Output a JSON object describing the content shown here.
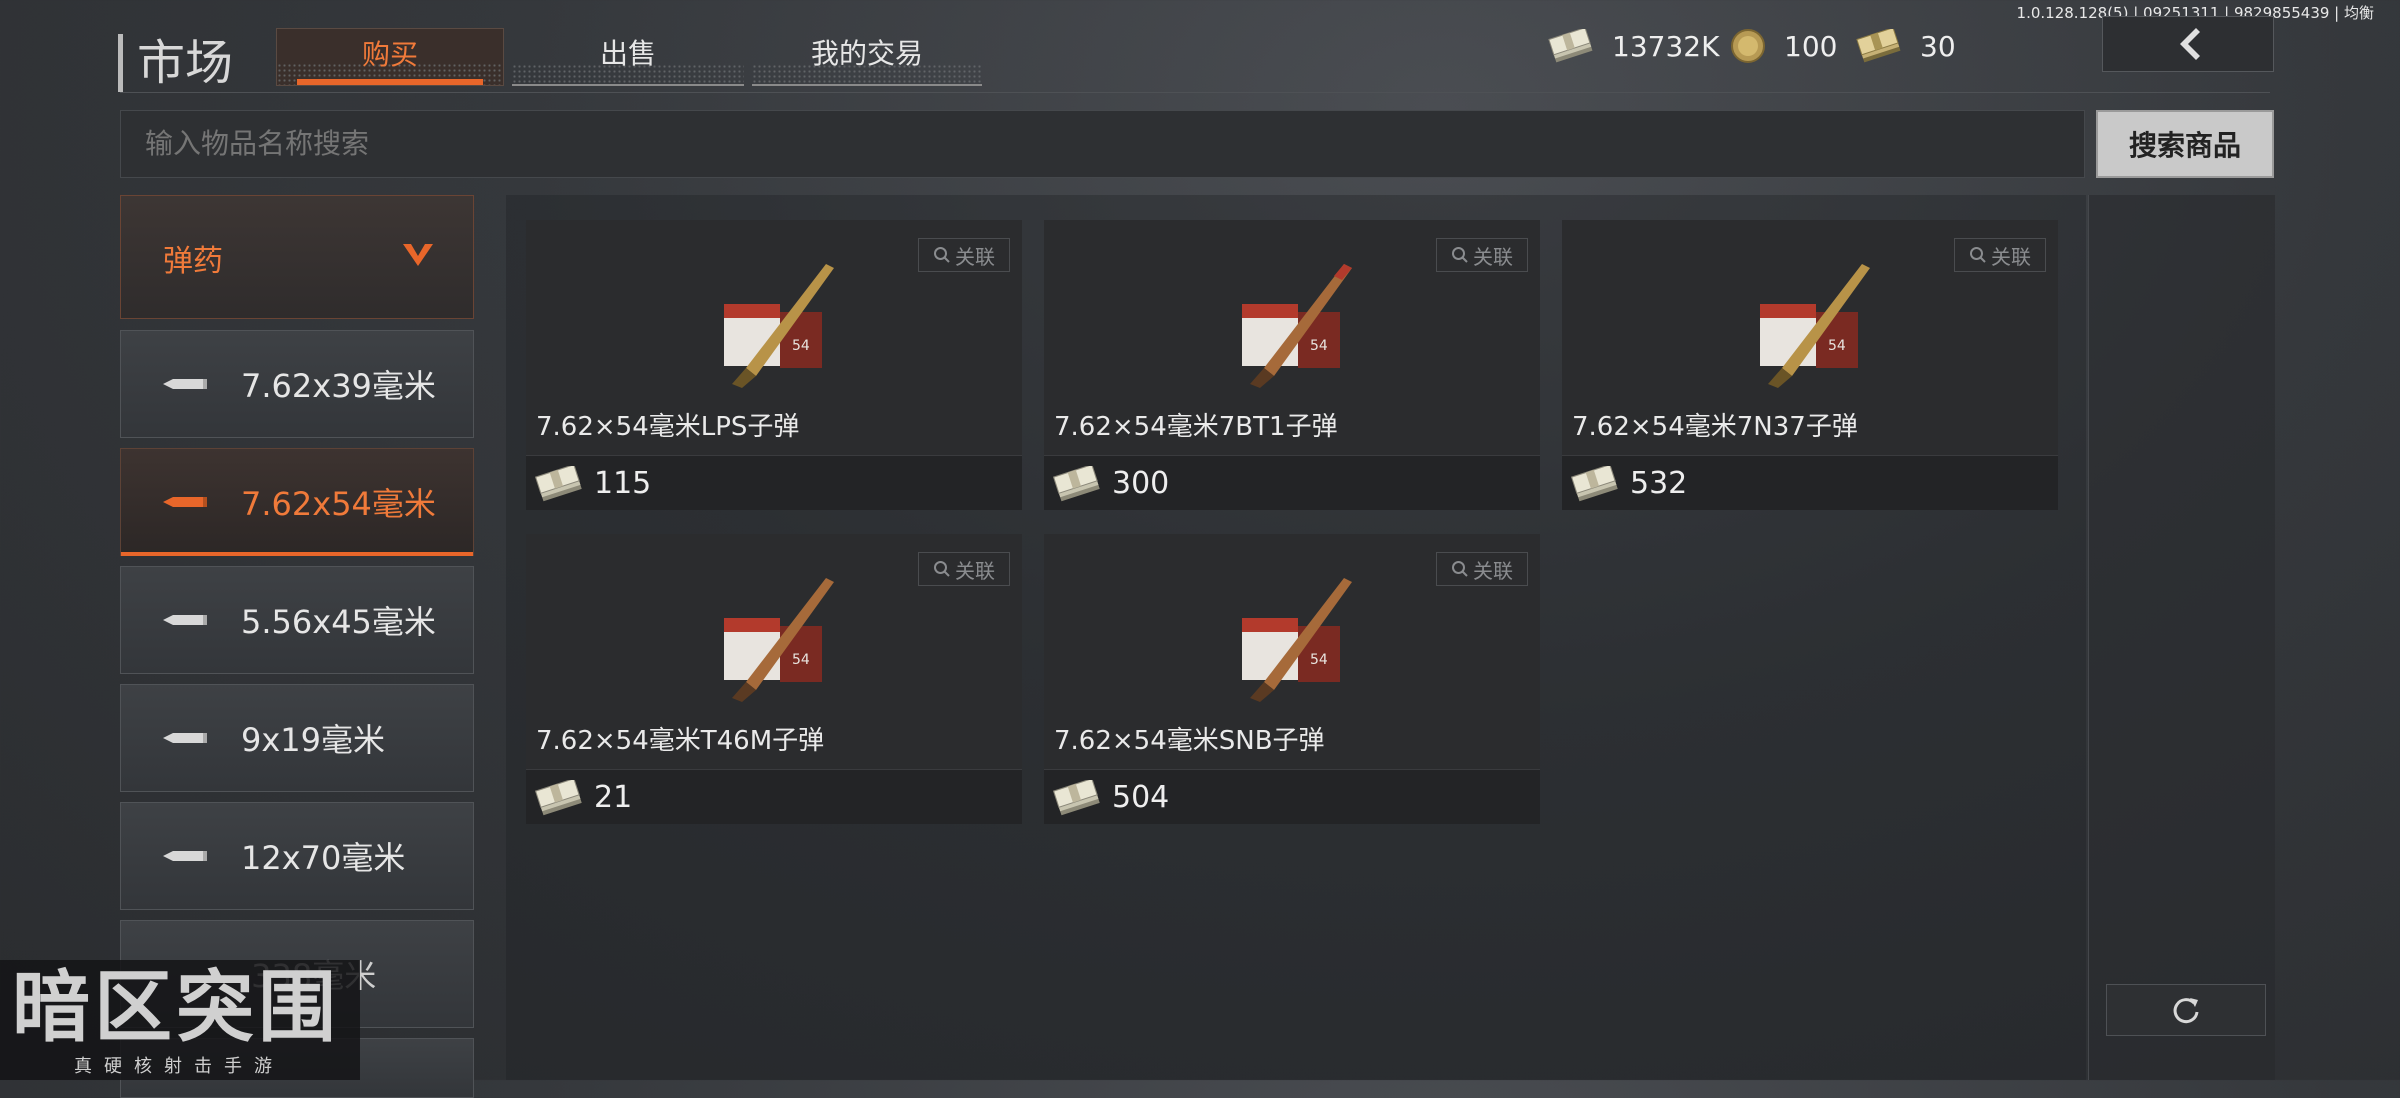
{
  "header": {
    "title": "市场",
    "tabs": [
      {
        "label": "购买",
        "active": true
      },
      {
        "label": "出售",
        "active": false
      },
      {
        "label": "我的交易",
        "active": false
      }
    ],
    "version": "1.0.128.128(5) | 09251311 | 9829855439 | 均衡"
  },
  "currencies": [
    {
      "icon": "cash-bundle-icon",
      "value": "13732K"
    },
    {
      "icon": "gold-coin-icon",
      "value": "100"
    },
    {
      "icon": "voucher-bundle-icon",
      "value": "30"
    }
  ],
  "search": {
    "placeholder": "输入物品名称搜索",
    "button_label": "搜索商品"
  },
  "category": {
    "label": "弹药",
    "items": [
      {
        "label": "7.62x39毫米",
        "active": false
      },
      {
        "label": "7.62x54毫米",
        "active": true
      },
      {
        "label": "5.56x45毫米",
        "active": false
      },
      {
        "label": "9x19毫米",
        "active": false
      },
      {
        "label": "12x70毫米",
        "active": false
      },
      {
        "label": ".338毫米",
        "active": false
      }
    ]
  },
  "products": [
    {
      "name": "7.62×54毫米LPS子弹",
      "price": "115",
      "link_label": "关联"
    },
    {
      "name": "7.62×54毫米7BT1子弹",
      "price": "300",
      "link_label": "关联"
    },
    {
      "name": "7.62×54毫米7N37子弹",
      "price": "532",
      "link_label": "关联"
    },
    {
      "name": "7.62×54毫米T46M子弹",
      "price": "21",
      "link_label": "关联"
    },
    {
      "name": "7.62×54毫米SNB子弹",
      "price": "504",
      "link_label": "关联"
    }
  ],
  "logo": {
    "title": "暗区突围",
    "subtitle": "真硬核射击手游"
  },
  "colors": {
    "accent": "#e8662a",
    "background": "#35383c",
    "card": "#2b2c2e"
  }
}
